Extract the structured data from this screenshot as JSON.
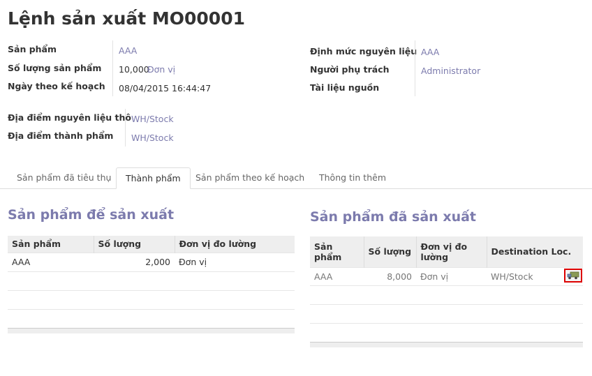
{
  "title": "Lệnh sản xuất MO00001",
  "fields_left": [
    {
      "label": "Sản phẩm",
      "value": "AAA"
    },
    {
      "label": "Số lượng sản phẩm",
      "value": "10,000",
      "unit": "Đơn vị"
    },
    {
      "label": "Ngày theo kế hoạch",
      "value": "08/04/2015 16:44:47"
    }
  ],
  "fields_right": [
    {
      "label": "Định mức nguyên liệu",
      "value": "AAA"
    },
    {
      "label": "Người phụ trách",
      "value": "Administrator"
    },
    {
      "label": "Tài liệu nguồn",
      "value": ""
    }
  ],
  "locations": [
    {
      "label": "Địa điểm nguyên liệu thô",
      "value": "WH/Stock"
    },
    {
      "label": "Địa điểm thành phẩm",
      "value": "WH/Stock"
    }
  ],
  "tabs": [
    {
      "label": "Sản phẩm đã tiêu thụ"
    },
    {
      "label": "Thành phẩm"
    },
    {
      "label": "Sản phẩm theo kế hoạch"
    },
    {
      "label": "Thông tin thêm"
    }
  ],
  "active_tab": "Thành phẩm",
  "to_produce": {
    "title": "Sản phẩm để sản xuất",
    "columns": [
      "Sản phẩm",
      "Số lượng",
      "Đơn vị đo lường"
    ],
    "rows": [
      {
        "product": "AAA",
        "qty": "2,000",
        "uom": "Đơn vị"
      }
    ]
  },
  "produced": {
    "title": "Sản phẩm đã sản xuất",
    "columns": [
      "Sản phẩm",
      "Số lượng",
      "Đơn vị đo lường",
      "Destination Loc."
    ],
    "rows": [
      {
        "product": "AAA",
        "qty": "8,000",
        "uom": "Đơn vị",
        "dest": "WH/Stock"
      }
    ]
  },
  "icons": {
    "move_action": "truck-move-icon"
  },
  "colors": {
    "link": "#7c7bad",
    "highlight": "#dd0000"
  }
}
